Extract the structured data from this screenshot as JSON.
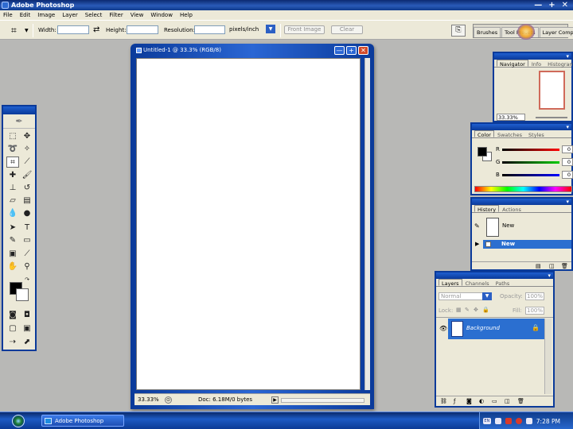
{
  "app": {
    "title": "Adobe Photoshop"
  },
  "window_controls": {
    "minimize": "—",
    "maximize": "+",
    "close": "✕"
  },
  "menu": [
    "File",
    "Edit",
    "Image",
    "Layer",
    "Select",
    "Filter",
    "View",
    "Window",
    "Help"
  ],
  "options": {
    "width_label": "Width:",
    "height_label": "Height:",
    "resolution_label": "Resolution:",
    "unit_value": "pixels/inch",
    "front_image": "Front Image",
    "clear": "Clear",
    "swap_glyph": "⇄"
  },
  "palette_well": {
    "tabs": [
      "Brushes",
      "Tool Presets",
      "Layer Comps"
    ]
  },
  "document": {
    "title": "Untitled-1 @ 33.3% (RGB/8)",
    "zoom": "33.33%",
    "doc_info": "Doc: 6.18M/0 bytes"
  },
  "navigator": {
    "tabs": [
      "Navigator",
      "Info",
      "Histogram"
    ],
    "zoom": "33.33%"
  },
  "color": {
    "tabs": [
      "Color",
      "Swatches",
      "Styles"
    ],
    "r_label": "R",
    "g_label": "G",
    "b_label": "B",
    "r": "0",
    "g": "0",
    "b": "0"
  },
  "history": {
    "tabs": [
      "History",
      "Actions"
    ],
    "snapshot": "New",
    "state": "New"
  },
  "layers": {
    "tabs": [
      "Layers",
      "Channels",
      "Paths"
    ],
    "blend_mode": "Normal",
    "opacity_label": "Opacity:",
    "opacity": "100%",
    "lock_label": "Lock:",
    "fill_label": "Fill:",
    "fill": "100%",
    "layer_name": "Background"
  },
  "taskbar": {
    "task": "Adobe Photoshop",
    "lang": "EN",
    "clock": "7:28 PM"
  },
  "colors": {
    "titlebar": "#1d4aa8",
    "panel_bg": "#ece9d8",
    "selected": "#2b6fd0",
    "workspace": "#b8b8b6"
  }
}
